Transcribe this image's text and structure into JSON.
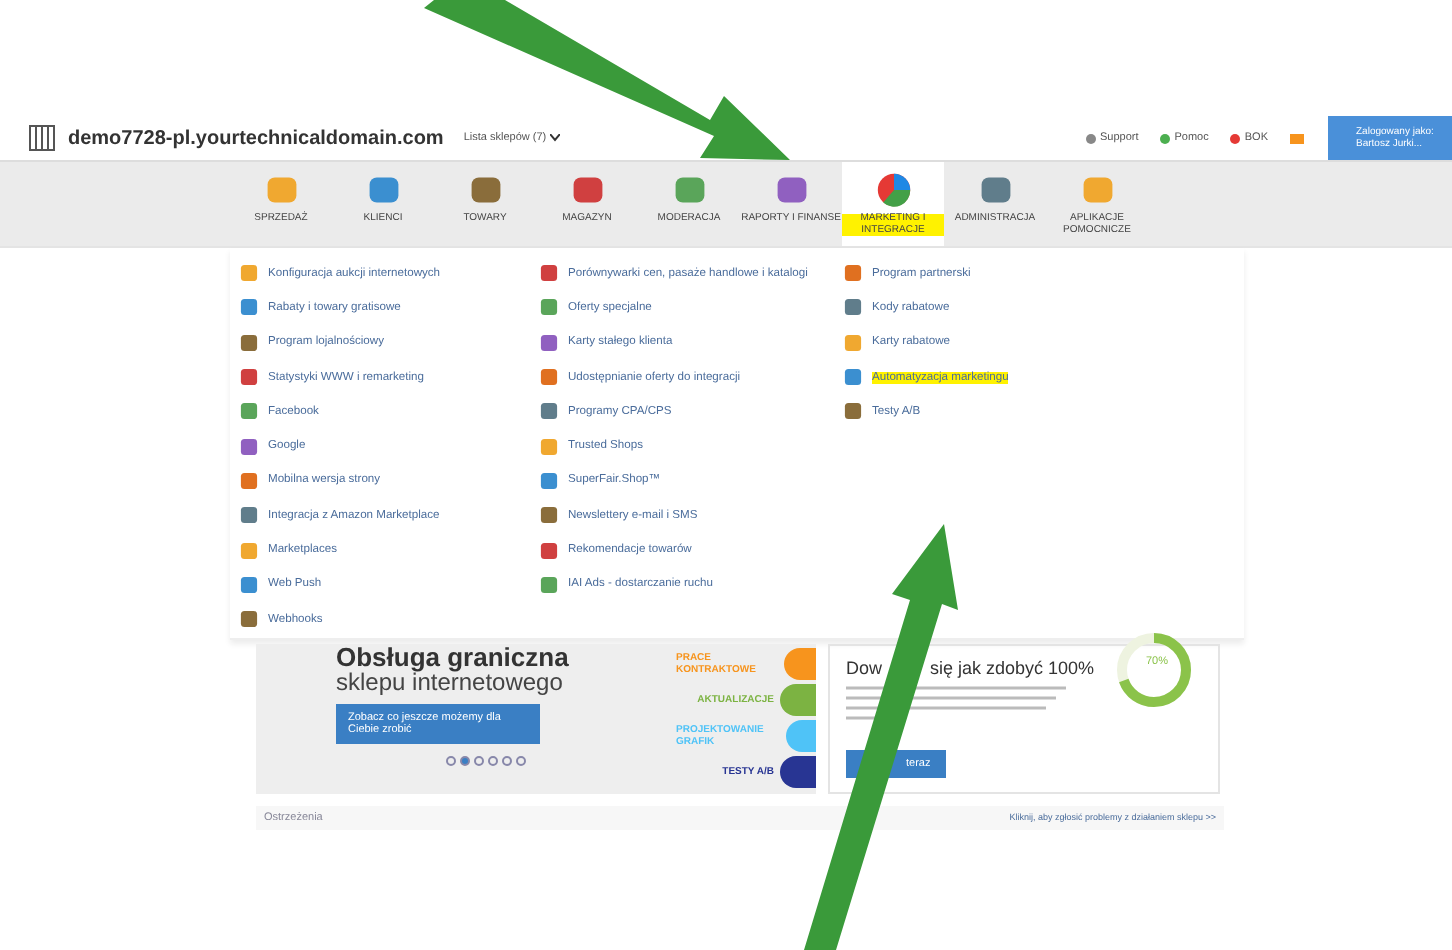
{
  "header": {
    "domain": "demo7728-pl.yourtechnicaldomain.com",
    "shop_list": "Lista sklepów (7)",
    "links": [
      "Support",
      "Pomoc",
      "BOK"
    ],
    "user": {
      "line1": "Zalogowany jako:",
      "line2": "Bartosz Jurki..."
    }
  },
  "nav": [
    {
      "label": "SPRZEDAŻ",
      "selected": false,
      "highlighted": false
    },
    {
      "label": "KLIENCI",
      "selected": false,
      "highlighted": false
    },
    {
      "label": "TOWARY",
      "selected": false,
      "highlighted": false
    },
    {
      "label": "MAGAZYN",
      "selected": false,
      "highlighted": false
    },
    {
      "label": "MODERACJA",
      "selected": false,
      "highlighted": false
    },
    {
      "label": "RAPORTY I FINANSE",
      "selected": false,
      "highlighted": false
    },
    {
      "label": "MARKETING I INTEGRACJE",
      "selected": true,
      "highlighted": true
    },
    {
      "label": "ADMINISTRACJA",
      "selected": false,
      "highlighted": false
    },
    {
      "label": "APLIKACJE POMOCNICZE",
      "selected": false,
      "highlighted": false
    }
  ],
  "menu_columns": [
    [
      {
        "label": "Konfiguracja aukcji internetowych",
        "highlighted": false
      },
      {
        "label": "Rabaty i towary gratisowe",
        "highlighted": false
      },
      {
        "label": "Program lojalnościowy",
        "highlighted": false
      },
      {
        "label": "Statystyki WWW i remarketing",
        "highlighted": false
      },
      {
        "label": "Facebook",
        "highlighted": false
      },
      {
        "label": "Google",
        "highlighted": false
      },
      {
        "label": "Mobilna wersja strony",
        "highlighted": false
      },
      {
        "label": "Integracja z Amazon Marketplace",
        "highlighted": false
      },
      {
        "label": "Marketplaces",
        "highlighted": false
      },
      {
        "label": "Web Push",
        "highlighted": false
      },
      {
        "label": "Webhooks",
        "highlighted": false
      }
    ],
    [
      {
        "label": "Porównywarki cen, pasaże handlowe i katalogi",
        "highlighted": false
      },
      {
        "label": "Oferty specjalne",
        "highlighted": false
      },
      {
        "label": "Karty stałego klienta",
        "highlighted": false
      },
      {
        "label": "Udostępnianie oferty do integracji",
        "highlighted": false
      },
      {
        "label": "Programy CPA/CPS",
        "highlighted": false
      },
      {
        "label": "Trusted Shops",
        "highlighted": false
      },
      {
        "label": "SuperFair.Shop™",
        "highlighted": false
      },
      {
        "label": "Newslettery e-mail i SMS",
        "highlighted": false
      },
      {
        "label": "Rekomendacje towarów",
        "highlighted": false
      },
      {
        "label": "IAI Ads - dostarczanie ruchu",
        "highlighted": false
      }
    ],
    [
      {
        "label": "Program partnerski",
        "highlighted": false
      },
      {
        "label": "Kody rabatowe",
        "highlighted": false
      },
      {
        "label": "Karty rabatowe",
        "highlighted": false
      },
      {
        "label": "Automatyzacja marketingu",
        "highlighted": true
      },
      {
        "label": "Testy A/B",
        "highlighted": false
      }
    ]
  ],
  "banner": {
    "title": "Obsługa graniczna",
    "subtitle": "sklepu internetowego",
    "cta": "Zobacz co jeszcze możemy dla Ciebie zrobić",
    "services": [
      {
        "label": "PRACE KONTRAKTOWE",
        "color": "#f7941d"
      },
      {
        "label": "AKTUALIZACJE",
        "color": "#7cb342"
      },
      {
        "label": "PROJEKTOWANIE GRAFIK",
        "color": "#4fc3f7"
      },
      {
        "label": "TESTY A/B",
        "color": "#283593"
      }
    ],
    "dots": [
      {
        "selected": false
      },
      {
        "selected": true
      },
      {
        "selected": false
      },
      {
        "selected": false
      },
      {
        "selected": false
      },
      {
        "selected": false
      }
    ]
  },
  "promo": {
    "heading_parts": [
      "Dow",
      "się jak zdobyć 100%"
    ],
    "button": "teraz",
    "progress": {
      "level": 0.7,
      "reading": "70%"
    }
  },
  "warnings": {
    "title": "Ostrzeżenia",
    "link": "Kliknij, aby zgłosić problemy z działaniem sklepu >>"
  }
}
